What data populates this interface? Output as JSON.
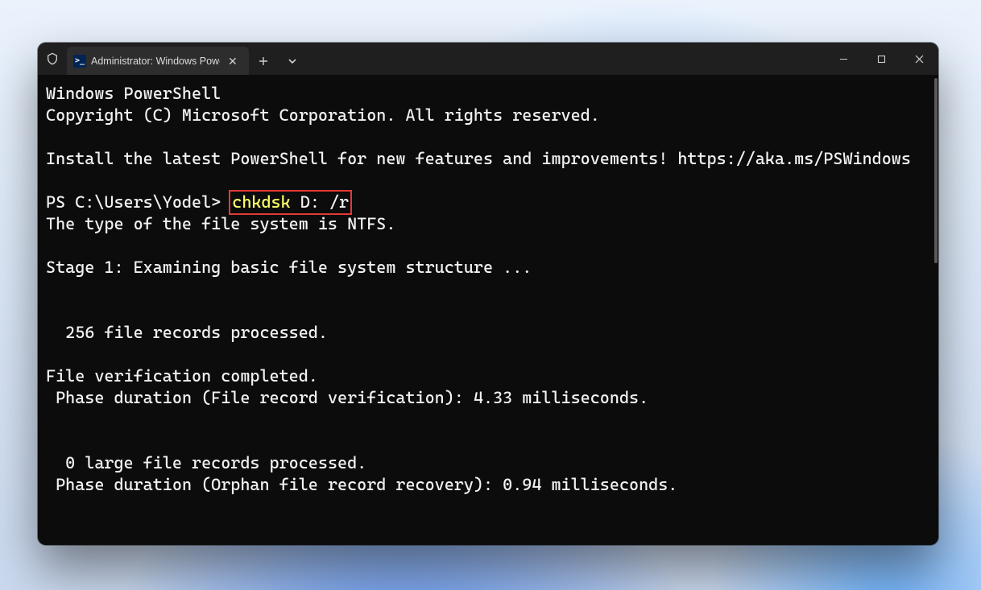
{
  "tab": {
    "title": "Administrator: Windows Powe"
  },
  "terminal": {
    "header1": "Windows PowerShell",
    "header2": "Copyright (C) Microsoft Corporation. All rights reserved.",
    "install_hint": "Install the latest PowerShell for new features and improvements! https://aka.ms/PSWindows",
    "prompt": "PS C:\\Users\\Yodel>",
    "command": "chkdsk",
    "command_args": "D: /r",
    "lines": {
      "fs_type": "The type of the file system is NTFS.",
      "stage1": "Stage 1: Examining basic file system structure ...",
      "records": "  256 file records processed.",
      "verify_done": "File verification completed.",
      "phase1": " Phase duration (File record verification): 4.33 milliseconds.",
      "large_records": "  0 large file records processed.",
      "phase2": " Phase duration (Orphan file record recovery): 0.94 milliseconds."
    }
  }
}
